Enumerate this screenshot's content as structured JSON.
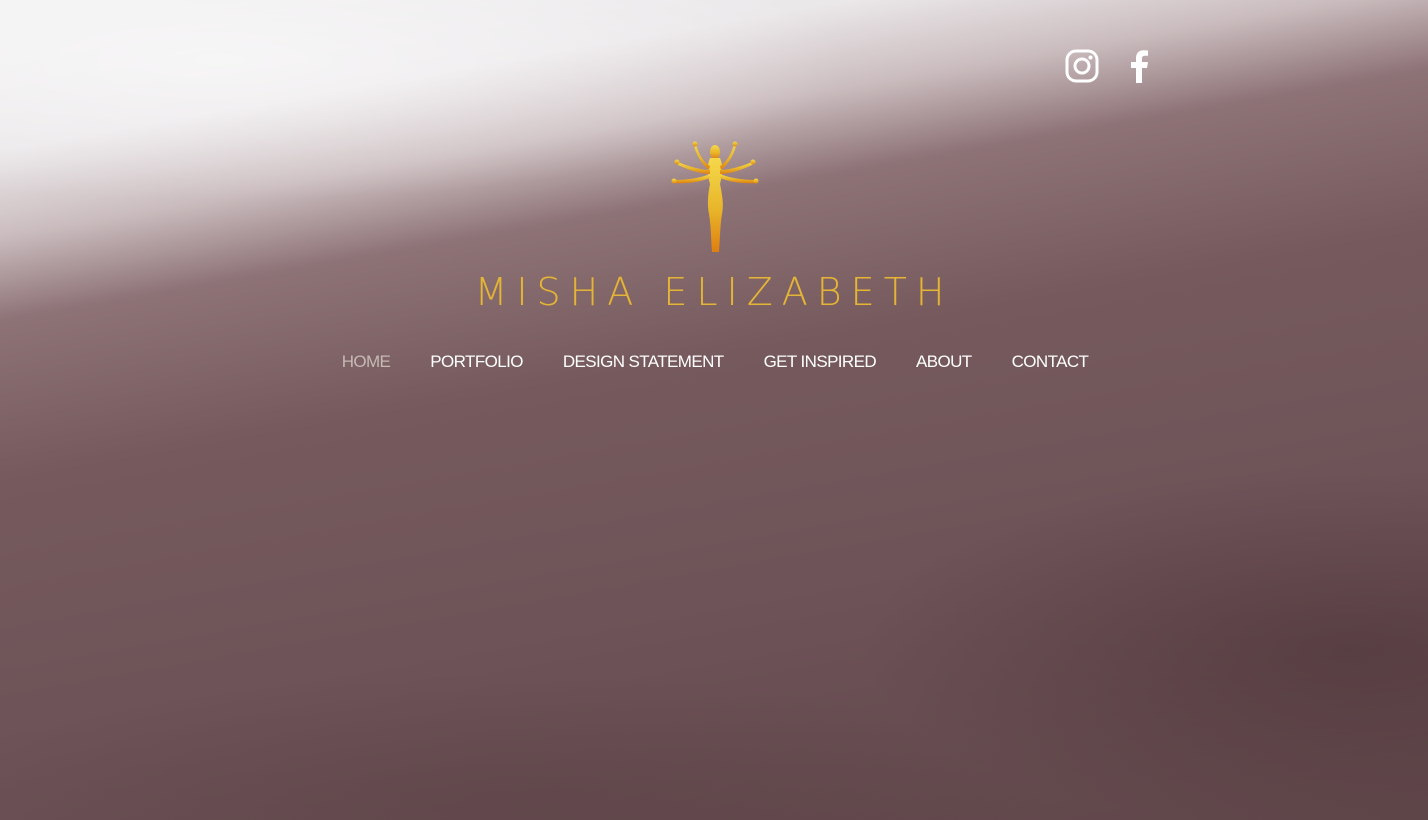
{
  "site": {
    "brand_name": "MISHA ELIZABETH",
    "logo_icon": "golden-goddess-figure-icon"
  },
  "social": [
    {
      "name": "instagram-icon"
    },
    {
      "name": "facebook-icon"
    }
  ],
  "nav": {
    "items": [
      {
        "label": "HOME",
        "active": true
      },
      {
        "label": "PORTFOLIO"
      },
      {
        "label": "DESIGN STATEMENT"
      },
      {
        "label": "GET INSPIRED"
      },
      {
        "label": "ABOUT"
      },
      {
        "label": "CONTACT"
      }
    ]
  },
  "colors": {
    "brand_gold": "#e2b43c",
    "nav_active": "#c7b9b3",
    "nav_text": "#ffffff",
    "background": "#72585c"
  }
}
